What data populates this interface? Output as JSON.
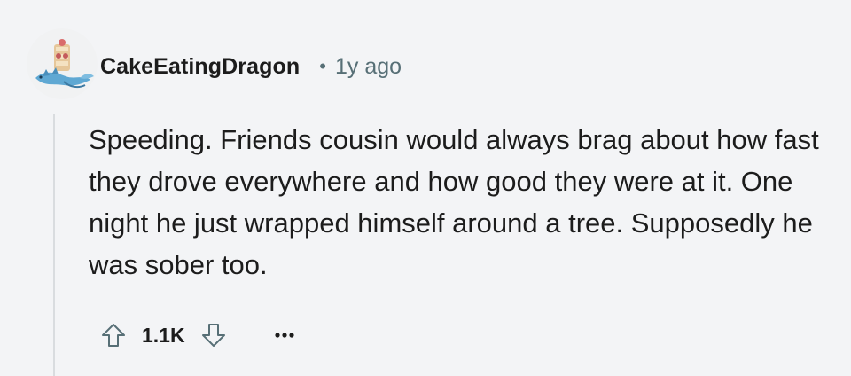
{
  "comment": {
    "username": "CakeEatingDragon",
    "separator": "•",
    "age": "1y ago",
    "body": "Speeding. Friends cousin would always brag about how fast they drove everywhere and how good they were at it. One night he just wrapped himself around a tree. Supposedly he was sober too.",
    "score": "1.1K",
    "avatar_icon": "dragon-avatar-icon",
    "upvote_icon": "upvote-arrow-icon",
    "downvote_icon": "downvote-arrow-icon",
    "more_icon": "more-options-icon"
  },
  "colors": {
    "background": "#f3f4f6",
    "text": "#1c1c1c",
    "meta_text": "#576f76",
    "thread_line": "#d9dcdf",
    "avatar_blue": "#5fa8d3"
  }
}
